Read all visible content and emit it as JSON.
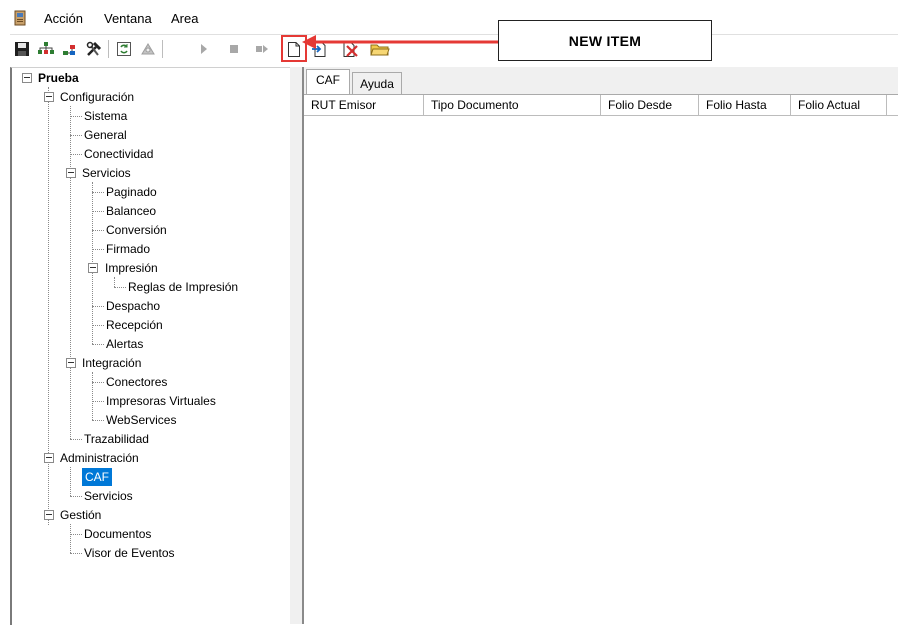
{
  "menu": {
    "items": [
      "Acción",
      "Ventana",
      "Area"
    ]
  },
  "toolbar": {
    "buttons": [
      "save-icon",
      "network-icon",
      "add-node-icon",
      "tools-icon",
      "refresh-icon",
      "settings-icon",
      "play-icon",
      "stop-icon",
      "next-icon",
      "new-item-icon",
      "import-icon",
      "delete-icon",
      "folder-icon"
    ],
    "highlight_color": "#e53935"
  },
  "annotation": {
    "label": "NEW ITEM"
  },
  "tree": {
    "root": "Prueba",
    "configuracion": "Configuración",
    "sistema": "Sistema",
    "general": "General",
    "conectividad": "Conectividad",
    "servicios": "Servicios",
    "paginado": "Paginado",
    "balanceo": "Balanceo",
    "conversion": "Conversión",
    "firmado": "Firmado",
    "impresion": "Impresión",
    "reglas": "Reglas de Impresión",
    "despacho": "Despacho",
    "recepcion": "Recepción",
    "alertas": "Alertas",
    "integracion": "Integración",
    "conectores": "Conectores",
    "impresoras": "Impresoras Virtuales",
    "webservices": "WebServices",
    "trazabilidad": "Trazabilidad",
    "administracion": "Administración",
    "caf": "CAF",
    "admin_servicios": "Servicios",
    "gestion": "Gestión",
    "documentos": "Documentos",
    "visor": "Visor de Eventos"
  },
  "tabs": [
    "CAF",
    "Ayuda"
  ],
  "grid": {
    "columns": [
      "RUT Emisor",
      "Tipo Documento",
      "Folio Desde",
      "Folio Hasta",
      "Folio Actual"
    ]
  }
}
